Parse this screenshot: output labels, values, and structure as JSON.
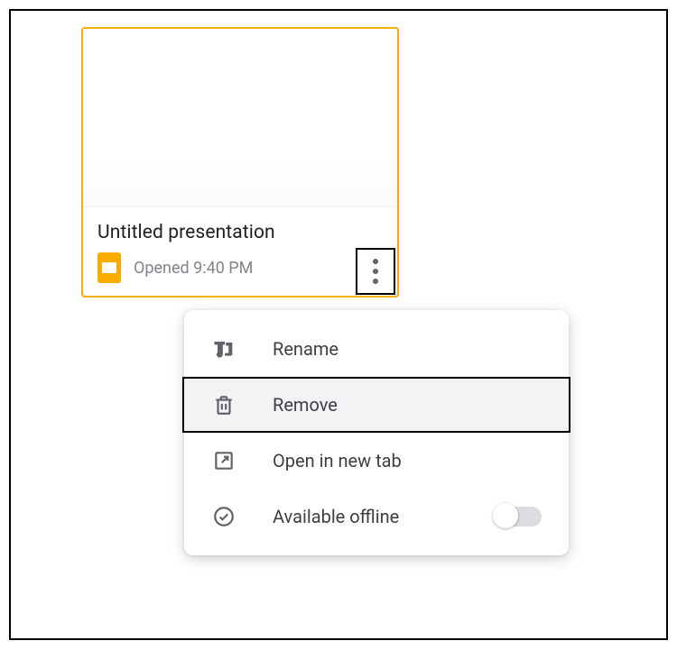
{
  "card": {
    "title": "Untitled presentation",
    "opened": "Opened 9:40 PM"
  },
  "menu": {
    "rename": "Rename",
    "remove": "Remove",
    "open_new_tab": "Open in new tab",
    "available_offline": "Available offline"
  }
}
